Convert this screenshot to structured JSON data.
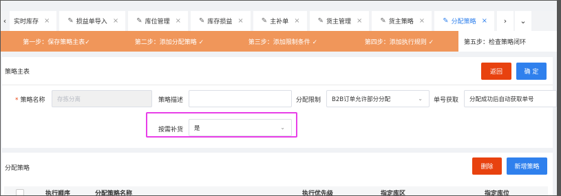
{
  "tabs": [
    {
      "label": "实时库存",
      "icon": "",
      "active": false
    },
    {
      "label": "损益单导入",
      "icon": "edit-icon",
      "active": false
    },
    {
      "label": "库位管理",
      "icon": "edit-icon",
      "active": false
    },
    {
      "label": "库存损益",
      "icon": "edit-icon",
      "active": false
    },
    {
      "label": "主补单",
      "icon": "edit-icon",
      "active": false
    },
    {
      "label": "货主管理",
      "icon": "edit-icon",
      "active": false
    },
    {
      "label": "货主策略",
      "icon": "edit-icon",
      "active": false
    },
    {
      "label": "分配策略",
      "icon": "edit-icon",
      "active": true
    }
  ],
  "tab_close_glyph": "×",
  "steps": [
    {
      "label": "第一步：保存策略主表✓"
    },
    {
      "label": "第二步：添加分配策略 ✓"
    },
    {
      "label": "第三步：添加限制条件 ✓"
    },
    {
      "label": "第四步：添加执行规则 ✓"
    },
    {
      "label": "第五步：检查策略闭环"
    }
  ],
  "main_section": {
    "title": "策略主表",
    "back_button": "返回",
    "confirm_button": "确 定",
    "fields": {
      "strategy_name": {
        "label": "策略名称",
        "placeholder": "存拣分离"
      },
      "strategy_desc": {
        "label": "策略描述",
        "value": ""
      },
      "alloc_limit": {
        "label": "分配限制",
        "value": "B2B订单允许部分分配"
      },
      "order_no": {
        "label": "单号获取",
        "value": "分配成功后自动获取单号"
      },
      "replenish": {
        "label": "按需补货",
        "value": "是"
      }
    }
  },
  "alloc_section": {
    "title": "分配策略",
    "delete_button": "删除",
    "add_button": "新增策略",
    "columns": [
      "执行顺序",
      "分配策略名称",
      "执行优先级",
      "指定库区",
      "指定库位"
    ]
  },
  "colors": {
    "accent": "#2f80ed",
    "step_done": "#f0965a",
    "danger": "#e8420f",
    "highlight": "#e83ee8"
  }
}
